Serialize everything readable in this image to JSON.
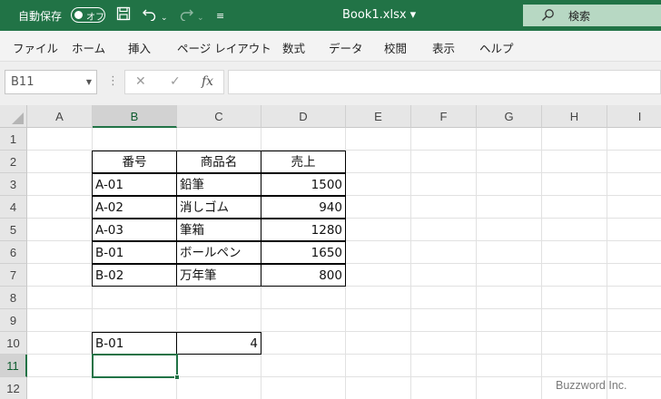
{
  "titlebar": {
    "autosave_label": "自動保存",
    "autosave_state": "オフ",
    "save_icon": "save-icon",
    "undo_icon": "undo-icon",
    "redo_icon": "redo-icon",
    "customize_icon": "customize-icon",
    "document_title": "Book1.xlsx ▾",
    "search_placeholder": "検索",
    "accent_color": "#217346"
  },
  "ribbon": {
    "tabs": [
      "ファイル",
      "ホーム",
      "挿入",
      "ページ レイアウト",
      "数式",
      "データ",
      "校閲",
      "表示",
      "ヘルプ"
    ]
  },
  "formula_bar": {
    "name_box": "B11",
    "cancel_symbol": "✕",
    "enter_symbol": "✓",
    "fx_label": "fx",
    "formula": ""
  },
  "sheet": {
    "columns": [
      "A",
      "B",
      "C",
      "D",
      "E",
      "F",
      "G",
      "H",
      "I"
    ],
    "rows": [
      "1",
      "2",
      "3",
      "4",
      "5",
      "6",
      "7",
      "8",
      "9",
      "10",
      "11",
      "12"
    ],
    "selected_column": "B",
    "selected_row": "11",
    "table": {
      "headers": [
        "番号",
        "商品名",
        "売上"
      ],
      "rows": [
        [
          "A-01",
          "鉛筆",
          "1500"
        ],
        [
          "A-02",
          "消しゴム",
          "940"
        ],
        [
          "A-03",
          "筆箱",
          "1280"
        ],
        [
          "B-01",
          "ボールペン",
          "1650"
        ],
        [
          "B-02",
          "万年筆",
          "800"
        ]
      ]
    },
    "lookup": {
      "key": "B-01",
      "result": "4"
    }
  },
  "watermark": "Buzzword Inc."
}
